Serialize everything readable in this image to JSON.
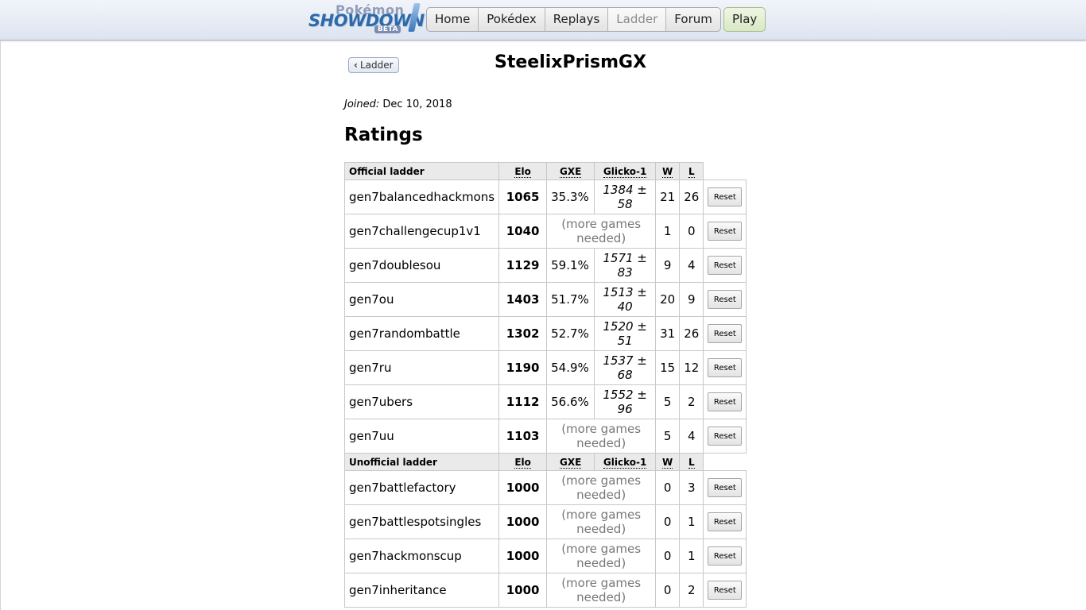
{
  "logo": {
    "top": "Pokémon",
    "main": "SHOWDOWN",
    "badge": "BETA"
  },
  "nav": [
    {
      "label": "Home",
      "current": false
    },
    {
      "label": "Pokédex",
      "current": false
    },
    {
      "label": "Replays",
      "current": false
    },
    {
      "label": "Ladder",
      "current": true
    },
    {
      "label": "Forum",
      "current": false
    }
  ],
  "play_label": "Play",
  "back_label": "Ladder",
  "username": "SteelixPrismGX",
  "joined": {
    "label": "Joined:",
    "date": "Dec 10, 2018"
  },
  "ratings_heading": "Ratings",
  "headers": {
    "elo": "Elo",
    "gxe": "GXE",
    "glicko": "Glicko-1",
    "w": "W",
    "l": "L"
  },
  "sections": [
    {
      "title": "Official ladder",
      "rows": [
        {
          "format": "gen7balancedhackmons",
          "elo": "1065",
          "gxe": "35.3%",
          "glicko": "1384 ± 58",
          "w": "21",
          "l": "26"
        },
        {
          "format": "gen7challengecup1v1",
          "elo": "1040",
          "more": "(more games needed)",
          "w": "1",
          "l": "0"
        },
        {
          "format": "gen7doublesou",
          "elo": "1129",
          "gxe": "59.1%",
          "glicko": "1571 ± 83",
          "w": "9",
          "l": "4"
        },
        {
          "format": "gen7ou",
          "elo": "1403",
          "gxe": "51.7%",
          "glicko": "1513 ± 40",
          "w": "20",
          "l": "9"
        },
        {
          "format": "gen7randombattle",
          "elo": "1302",
          "gxe": "52.7%",
          "glicko": "1520 ± 51",
          "w": "31",
          "l": "26"
        },
        {
          "format": "gen7ru",
          "elo": "1190",
          "gxe": "54.9%",
          "glicko": "1537 ± 68",
          "w": "15",
          "l": "12"
        },
        {
          "format": "gen7ubers",
          "elo": "1112",
          "gxe": "56.6%",
          "glicko": "1552 ± 96",
          "w": "5",
          "l": "2"
        },
        {
          "format": "gen7uu",
          "elo": "1103",
          "more": "(more games needed)",
          "w": "5",
          "l": "4"
        }
      ]
    },
    {
      "title": "Unofficial ladder",
      "rows": [
        {
          "format": "gen7battlefactory",
          "elo": "1000",
          "more": "(more games needed)",
          "w": "0",
          "l": "3"
        },
        {
          "format": "gen7battlespotsingles",
          "elo": "1000",
          "more": "(more games needed)",
          "w": "0",
          "l": "1"
        },
        {
          "format": "gen7hackmonscup",
          "elo": "1000",
          "more": "(more games needed)",
          "w": "0",
          "l": "1"
        },
        {
          "format": "gen7inheritance",
          "elo": "1000",
          "more": "(more games needed)",
          "w": "0",
          "l": "2"
        }
      ]
    }
  ],
  "reset_label": "Reset"
}
